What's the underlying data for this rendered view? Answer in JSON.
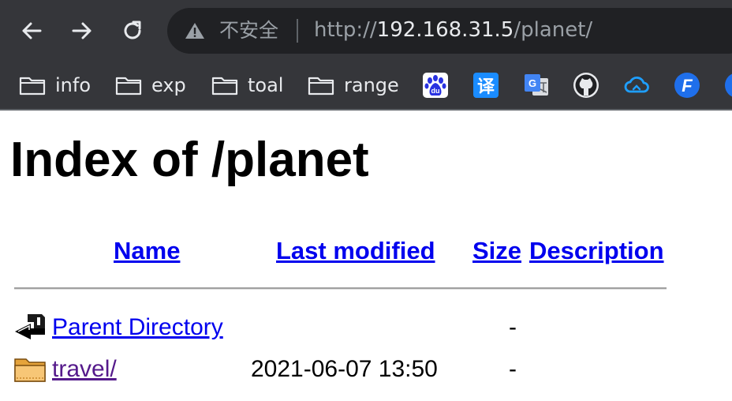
{
  "browser": {
    "omnibox": {
      "security_label": "不安全",
      "url_scheme": "http://",
      "url_host": "192.168.31.5",
      "url_path": "/planet/"
    },
    "bookmarks": [
      {
        "label": "info",
        "icon": "folder-icon"
      },
      {
        "label": "exp",
        "icon": "folder-icon"
      },
      {
        "label": "toal",
        "icon": "folder-icon"
      },
      {
        "label": "range",
        "icon": "folder-icon"
      }
    ],
    "bookmark_icons": [
      {
        "icon": "baidu-icon",
        "glyph": "du",
        "color": "#2932e1"
      },
      {
        "icon": "translate-icon",
        "glyph": "译",
        "color": "#1a8cff"
      },
      {
        "icon": "google-translate-icon",
        "glyph": "G",
        "color": "#4285f4"
      },
      {
        "icon": "github-icon",
        "color": "#000000"
      },
      {
        "icon": "cloud-icon",
        "color": "#1e9fff"
      },
      {
        "icon": "f-app-icon",
        "glyph": "F",
        "color": "#1f6feb"
      }
    ]
  },
  "page": {
    "title": "Index of /planet",
    "columns": {
      "name": "Name",
      "last_modified": "Last modified",
      "size": "Size",
      "description": "Description"
    },
    "rows": [
      {
        "icon": "back-icon",
        "name": "Parent Directory",
        "modified": "",
        "size": "-",
        "description": "",
        "visited": false
      },
      {
        "icon": "folder-icon",
        "name": "travel/",
        "modified": "2021-06-07 13:50",
        "size": "-",
        "description": "",
        "visited": true
      }
    ]
  }
}
